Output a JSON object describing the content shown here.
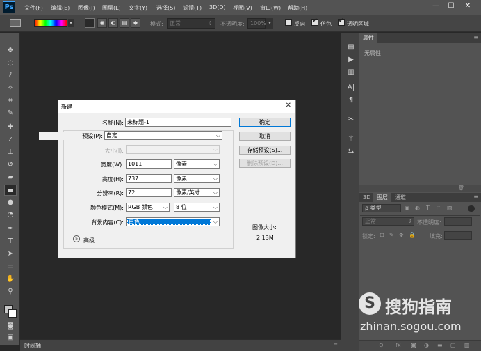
{
  "app": {
    "logo": "Ps"
  },
  "menu": [
    "文件(F)",
    "编辑(E)",
    "图像(I)",
    "图层(L)",
    "文字(Y)",
    "选择(S)",
    "滤镜(T)",
    "3D(D)",
    "视图(V)",
    "窗口(W)",
    "帮助(H)"
  ],
  "window_controls": {
    "minimize": "—",
    "maximize": "☐",
    "close": "✕"
  },
  "options": {
    "mode_label": "模式:",
    "mode_value": "正常",
    "opacity_label": "不透明度:",
    "opacity_value": "100%",
    "reverse_label": "反向",
    "dither_label": "仿色",
    "transparency_label": "透明区域"
  },
  "dock_bottom_label": "时间轴",
  "properties_panel": {
    "tab": "属性",
    "content": "无属性"
  },
  "layers_panel": {
    "tabs": [
      "3D",
      "图层",
      "通道"
    ],
    "filter_label": "ρ 类型",
    "blend_mode": "正常",
    "opacity_label": "不透明度:",
    "lock_label": "锁定:",
    "fill_label": "填充:"
  },
  "dialog": {
    "title": "新建",
    "close": "✕",
    "name_label": "名称(N):",
    "name_value": "未标题-1",
    "preset_label": "预设(P):",
    "preset_value": "自定",
    "size_label": "大小(I):",
    "width_label": "宽度(W):",
    "width_value": "1011",
    "width_unit": "像素",
    "height_label": "高度(H):",
    "height_value": "737",
    "height_unit": "像素",
    "resolution_label": "分辨率(R):",
    "resolution_value": "72",
    "resolution_unit": "像素/英寸",
    "color_mode_label": "颜色模式(M):",
    "color_mode_value": "RGB 颜色",
    "bit_depth_value": "8 位",
    "background_label": "背景内容(C):",
    "background_value": "白色",
    "advanced_label": "高级",
    "ok_label": "确定",
    "cancel_label": "取消",
    "save_preset_label": "存储预设(S)...",
    "delete_preset_label": "删除预设(D)...",
    "image_size_label": "图像大小:",
    "image_size_value": "2.13M"
  },
  "watermark": {
    "brand": "搜狗指南",
    "url": "zhinan.sogou.com"
  },
  "colors": {
    "accent": "#0078d7",
    "ps_blue": "#3ca5ff"
  }
}
